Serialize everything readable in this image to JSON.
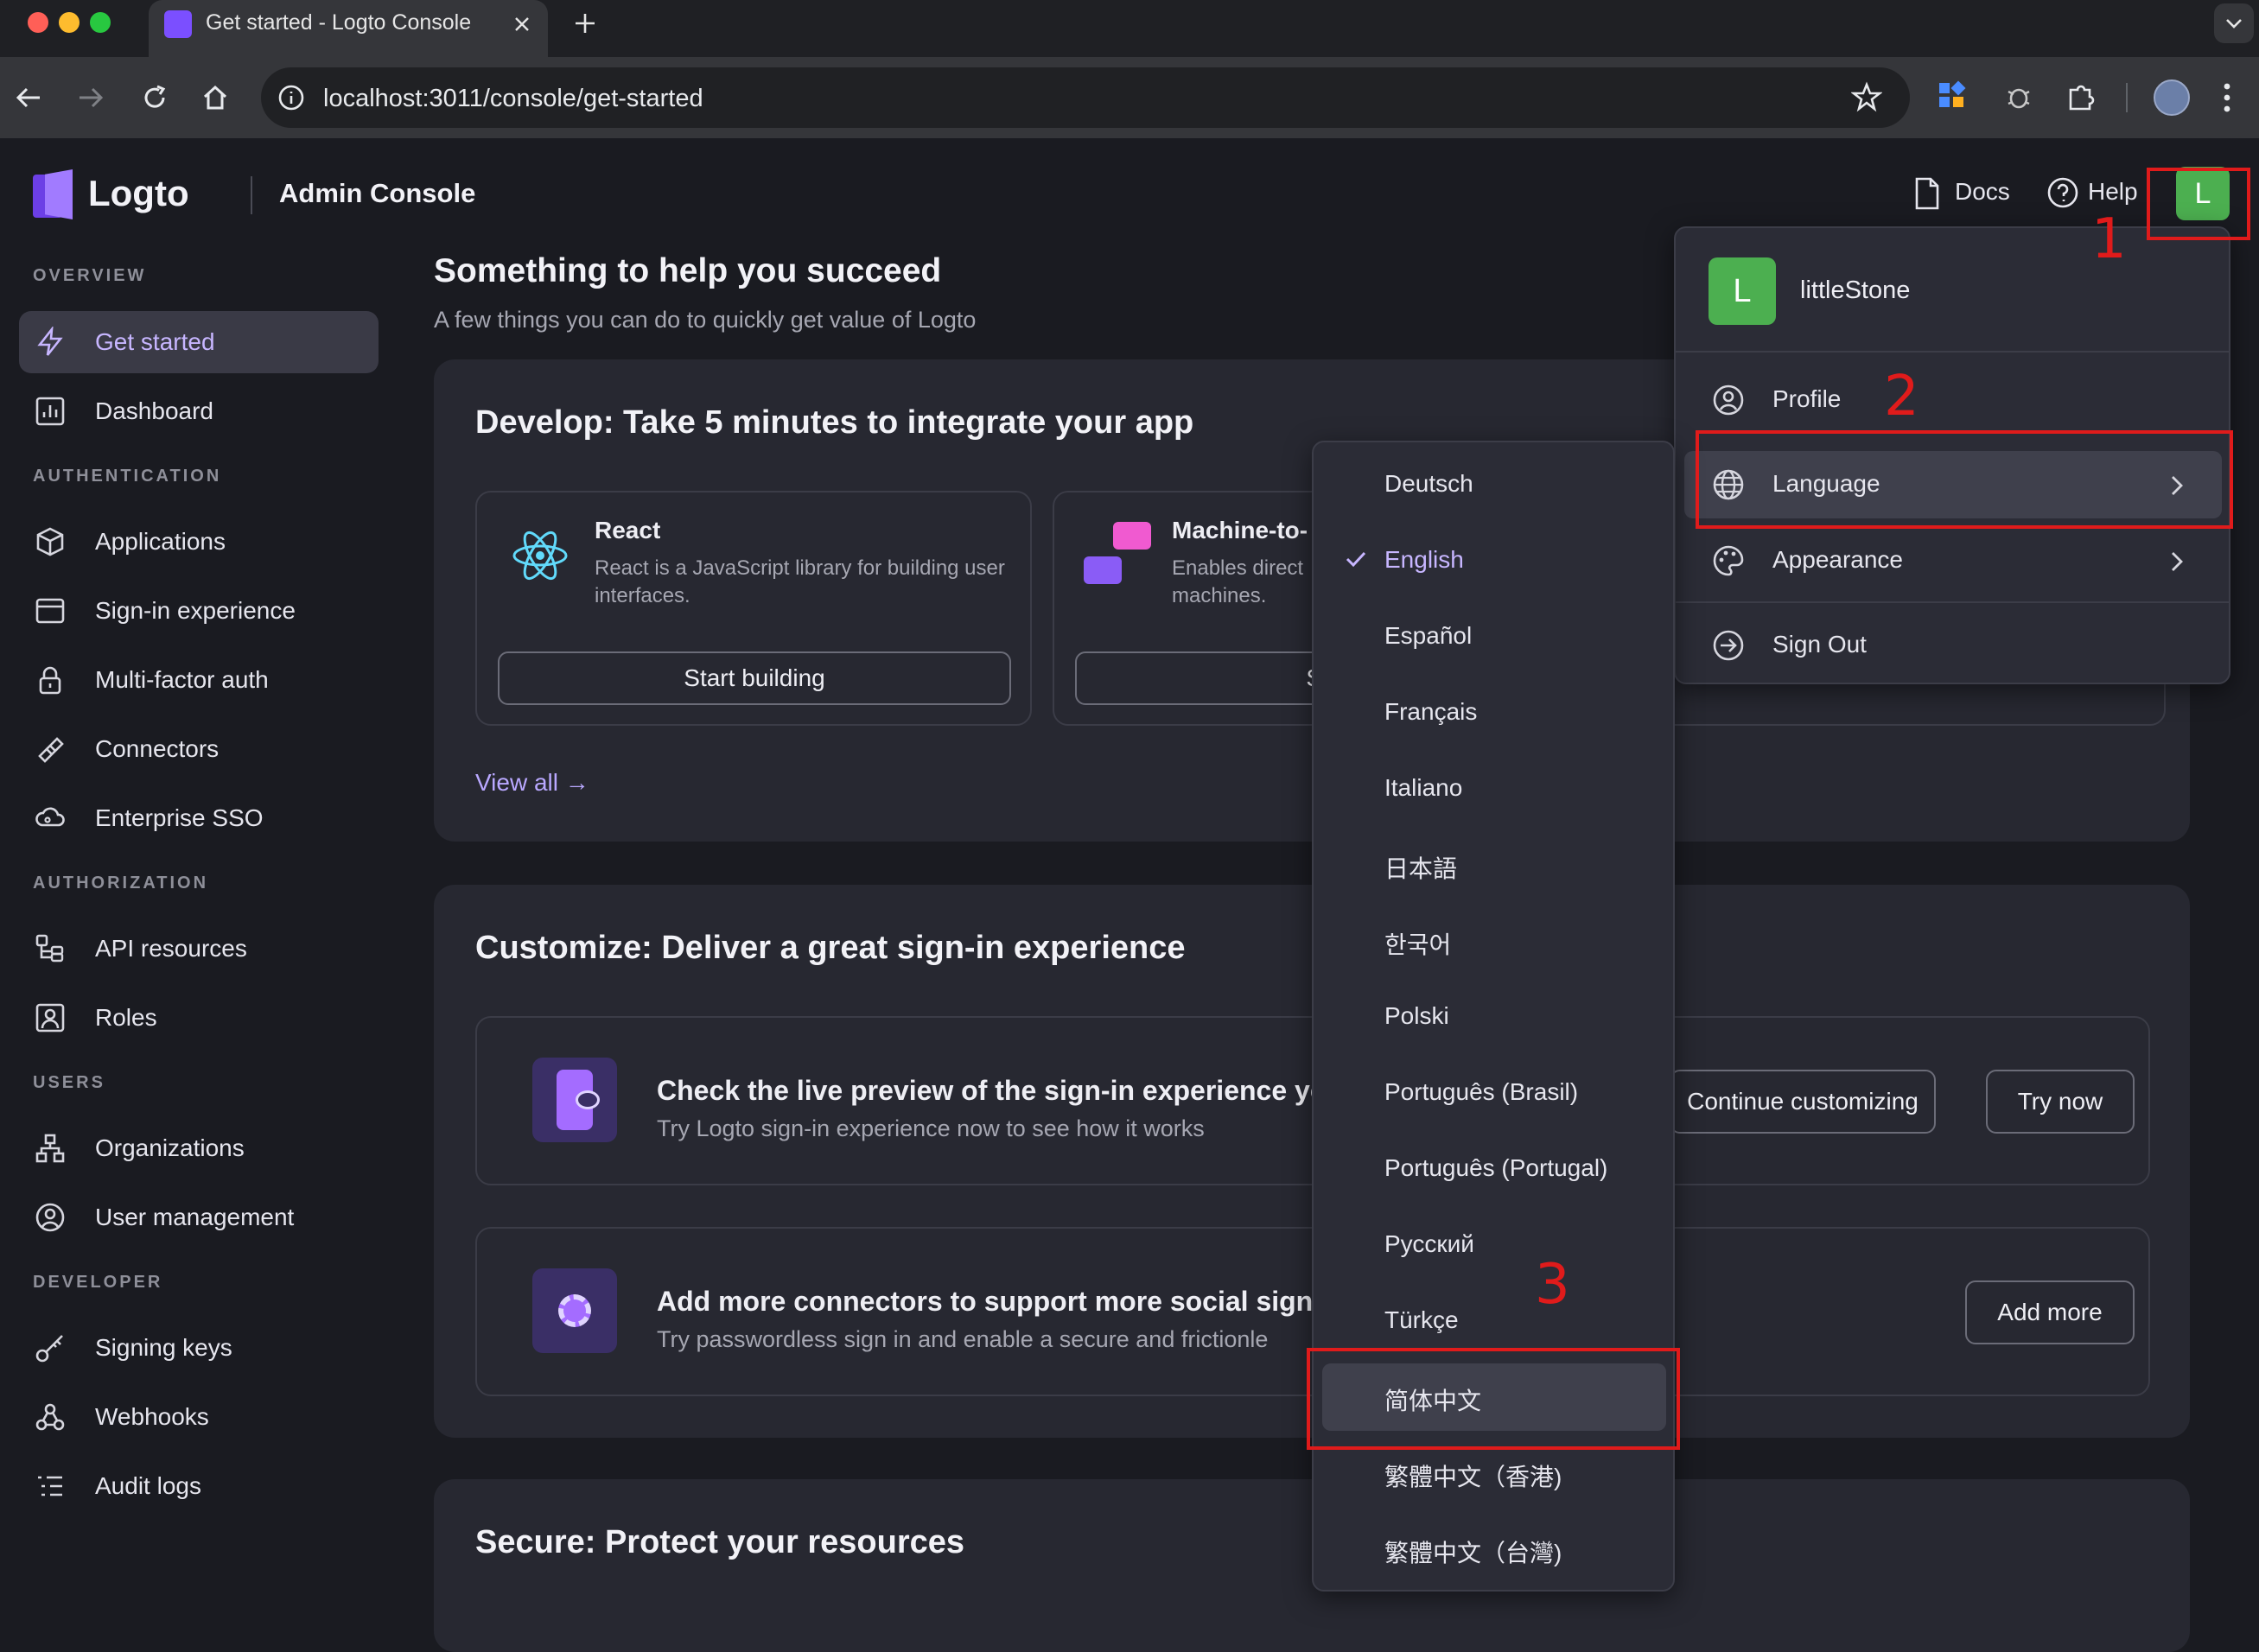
{
  "browser": {
    "tab_title": "Get started - Logto Console",
    "url": "localhost:3011/console/get-started"
  },
  "header": {
    "brand": "Logto",
    "console_label": "Admin Console",
    "docs": "Docs",
    "help": "Help",
    "avatar_letter": "L"
  },
  "sidebar": {
    "sections": {
      "overview": "OVERVIEW",
      "authentication": "AUTHENTICATION",
      "authorization": "AUTHORIZATION",
      "users": "USERS",
      "developer": "DEVELOPER"
    },
    "items": {
      "get_started": "Get started",
      "dashboard": "Dashboard",
      "applications": "Applications",
      "sign_in_experience": "Sign-in experience",
      "mfa": "Multi-factor auth",
      "connectors": "Connectors",
      "enterprise_sso": "Enterprise SSO",
      "api_resources": "API resources",
      "roles": "Roles",
      "organizations": "Organizations",
      "user_management": "User management",
      "signing_keys": "Signing keys",
      "webhooks": "Webhooks",
      "audit_logs": "Audit logs"
    }
  },
  "main": {
    "title": "Something to help you succeed",
    "subtitle": "A few things you can do to quickly get value of Logto",
    "develop": {
      "title": "Develop: Take 5 minutes to integrate your app",
      "react_title": "React",
      "react_desc": "React is a JavaScript library for building user interfaces.",
      "react_btn": "Start building",
      "m2m_title": "Machine-to-",
      "m2m_desc": "Enables direct machines.",
      "m2m_btn": "Start",
      "view_all": "View all →"
    },
    "customize": {
      "title": "Customize: Deliver a great sign-in experience",
      "preview_title": "Check the live preview of the sign-in experience yo",
      "preview_desc": "Try Logto sign-in experience now to see how it works",
      "continue_btn": "Continue customizing",
      "try_btn": "Try now",
      "connectors_title": "Add more connectors to support more social sign-",
      "connectors_desc": "Try passwordless sign in and enable a secure and frictionle",
      "add_more_btn": "Add more"
    },
    "secure": {
      "title": "Secure: Protect your resources"
    }
  },
  "user_menu": {
    "avatar_letter": "L",
    "username": "littleStone",
    "profile": "Profile",
    "language": "Language",
    "appearance": "Appearance",
    "sign_out": "Sign Out"
  },
  "languages": [
    "Deutsch",
    "English",
    "Español",
    "Français",
    "Italiano",
    "日本語",
    "한국어",
    "Polski",
    "Português (Brasil)",
    "Português (Portugal)",
    "Русский",
    "Türkçe",
    "简体中文",
    "繁體中文（香港)",
    "繁體中文（台灣)"
  ],
  "selected_language": "English",
  "annotations": {
    "one": "1",
    "two": "2",
    "three": "3"
  },
  "colors": {
    "accent": "#c7b6ff",
    "annotation": "#e01b1b",
    "avatar": "#4caf50"
  }
}
